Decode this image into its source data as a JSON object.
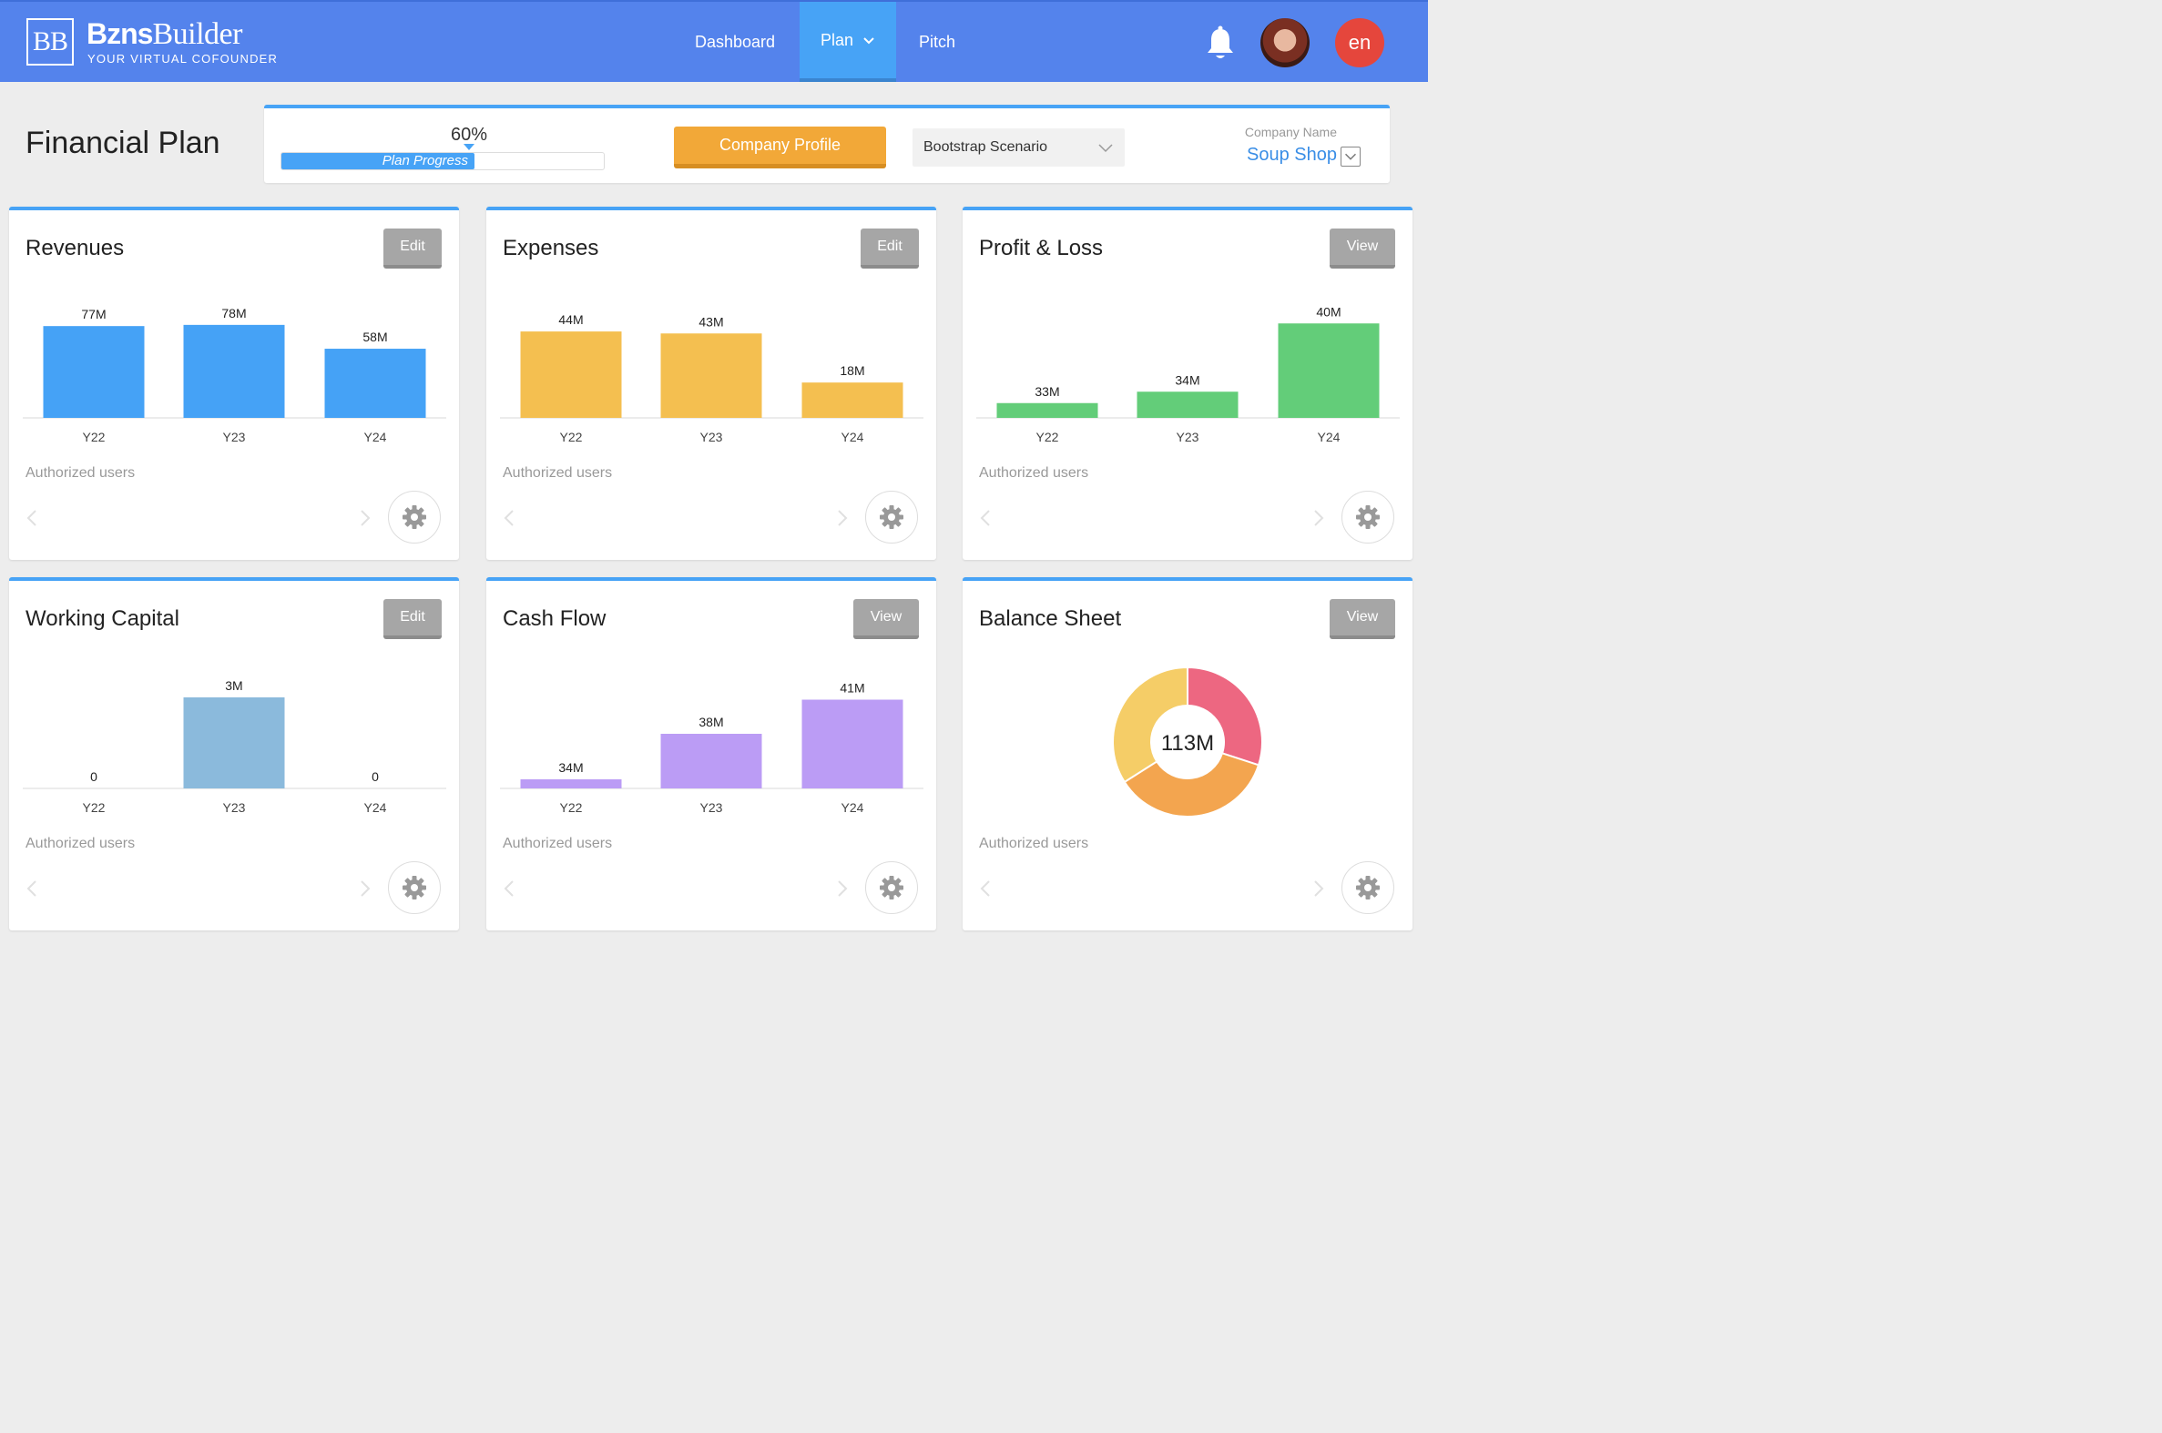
{
  "brand": {
    "mark": "BB",
    "name_bold": "Bzns",
    "name_rest": "Builder",
    "tagline": "YOUR VIRTUAL COFOUNDER"
  },
  "nav": {
    "items": [
      {
        "label": "Dashboard",
        "active": false
      },
      {
        "label": "Plan",
        "active": true
      },
      {
        "label": "Pitch",
        "active": false
      }
    ]
  },
  "user": {
    "language": "en"
  },
  "page": {
    "title": "Financial Plan"
  },
  "header": {
    "progress_percent_label": "60%",
    "progress_value": 0.6,
    "progress_label": "Plan Progress",
    "company_profile_label": "Company Profile",
    "scenario_value": "Bootstrap Scenario",
    "company_name_caption": "Company Name",
    "company_name_value": "Soup Shop"
  },
  "colors": {
    "accent": "#47a3f6",
    "revenues": "#45a2f6",
    "expenses": "#f4bf50",
    "profit_loss": "#63cd79",
    "working_capital": "#8bbadc",
    "cash_flow": "#bb9cf5",
    "donut": [
      "#ed6781",
      "#f3a54f",
      "#f5cd67"
    ]
  },
  "cards": [
    {
      "title": "Revenues",
      "button": "Edit",
      "footer": "Authorized users"
    },
    {
      "title": "Expenses",
      "button": "Edit",
      "footer": "Authorized users"
    },
    {
      "title": "Profit & Loss",
      "button": "View",
      "footer": "Authorized users"
    },
    {
      "title": "Working Capital",
      "button": "Edit",
      "footer": "Authorized users"
    },
    {
      "title": "Cash Flow",
      "button": "View",
      "footer": "Authorized users"
    },
    {
      "title": "Balance Sheet",
      "button": "View",
      "footer": "Authorized users"
    }
  ],
  "chart_data": [
    {
      "type": "bar",
      "title": "Revenues",
      "categories": [
        "Y22",
        "Y23",
        "Y24"
      ],
      "values": [
        77,
        78,
        58
      ],
      "labels": [
        "77M",
        "78M",
        "58M"
      ],
      "ylim": [
        0,
        84
      ],
      "color": "#45a2f6"
    },
    {
      "type": "bar",
      "title": "Expenses",
      "categories": [
        "Y22",
        "Y23",
        "Y24"
      ],
      "values": [
        44,
        43,
        18
      ],
      "labels": [
        "44M",
        "43M",
        "18M"
      ],
      "ylim": [
        0,
        51
      ],
      "color": "#f4bf50"
    },
    {
      "type": "bar",
      "title": "Profit & Loss",
      "categories": [
        "Y22",
        "Y23",
        "Y24"
      ],
      "values": [
        33,
        34,
        40
      ],
      "labels": [
        "33M",
        "34M",
        "40M"
      ],
      "ylim": [
        31.7,
        40.5
      ],
      "color": "#63cd79"
    },
    {
      "type": "bar",
      "title": "Working Capital",
      "categories": [
        "Y22",
        "Y23",
        "Y24"
      ],
      "values": [
        0,
        3,
        0
      ],
      "labels": [
        "0",
        "3M",
        "0"
      ],
      "ylim": [
        0,
        3.3
      ],
      "color": "#8bbadc"
    },
    {
      "type": "bar",
      "title": "Cash Flow",
      "categories": [
        "Y22",
        "Y23",
        "Y24"
      ],
      "values": [
        34,
        38,
        41
      ],
      "labels": [
        "34M",
        "38M",
        "41M"
      ],
      "ylim": [
        33.2,
        42
      ],
      "color": "#bb9cf5"
    },
    {
      "type": "pie",
      "title": "Balance Sheet",
      "center_label": "113M",
      "values": [
        0.3,
        0.36,
        0.34
      ],
      "colors": [
        "#ed6781",
        "#f3a54f",
        "#f5cd67"
      ]
    }
  ]
}
